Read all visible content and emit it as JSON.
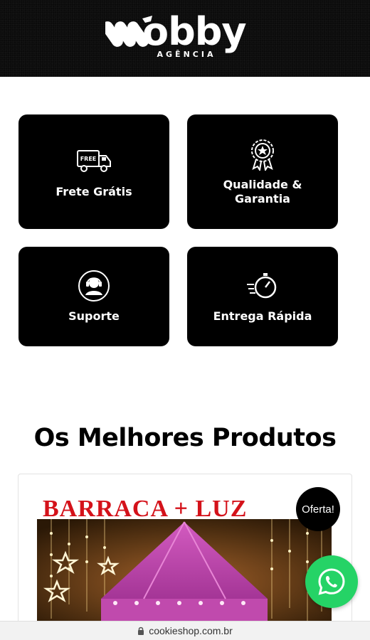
{
  "header": {
    "logo_text": "obby",
    "logo_sub": "AGÊNCIA"
  },
  "features": [
    {
      "label": "Frete Grátis",
      "icon": "truck-icon",
      "icon_text": "FREE"
    },
    {
      "label": "Qualidade & Garantia",
      "icon": "badge-star-icon"
    },
    {
      "label": "Suporte",
      "icon": "headset-support-icon"
    },
    {
      "label": "Entrega Rápida",
      "icon": "stopwatch-fast-icon"
    }
  ],
  "products_section": {
    "title": "Os Melhores Produtos",
    "product": {
      "title": "BARRACA  +  LUZ",
      "badge": "Oferta!"
    }
  },
  "whatsapp": {
    "icon": "whatsapp-icon"
  },
  "url_bar": {
    "url": "cookieshop.com.br",
    "icon": "lock-icon"
  },
  "colors": {
    "header_bg": "#0b0b0b",
    "card_bg": "#000000",
    "product_title": "#d4121a",
    "whatsapp": "#25d366"
  }
}
